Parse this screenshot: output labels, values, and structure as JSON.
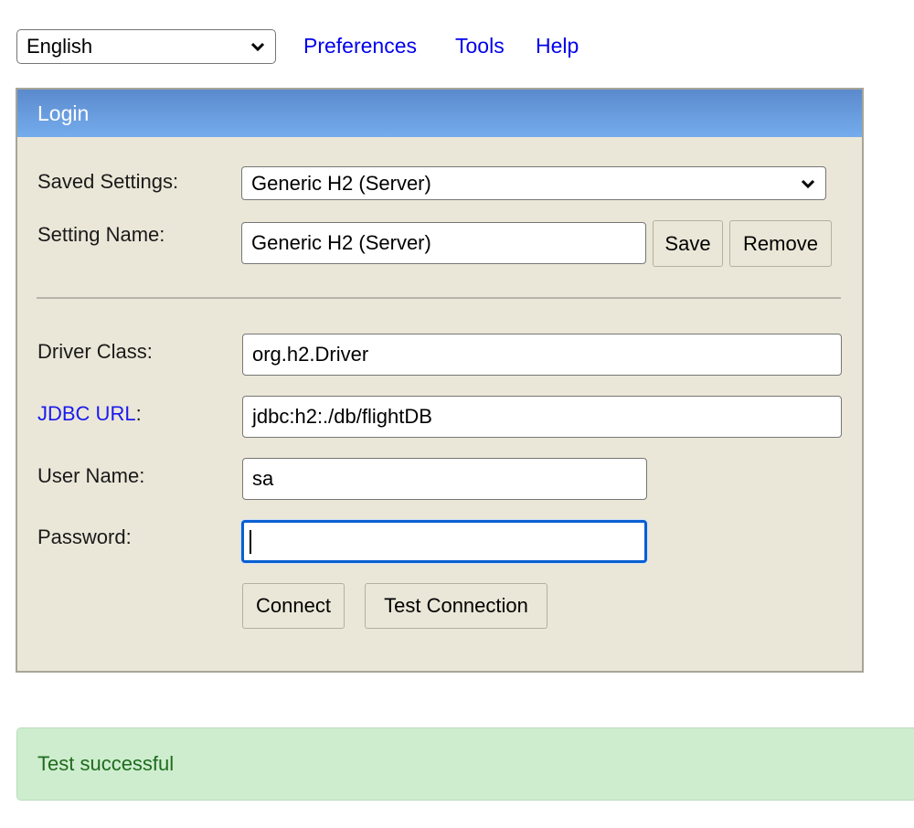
{
  "topbar": {
    "language": {
      "selected": "English",
      "icon": "chevron-down-icon"
    },
    "links": [
      "Preferences",
      "Tools",
      "Help"
    ]
  },
  "panel": {
    "title": "Login",
    "saved_settings": {
      "label": "Saved Settings:",
      "value": "Generic H2 (Server)"
    },
    "setting_name": {
      "label": "Setting Name:",
      "value": "Generic H2 (Server)"
    },
    "save_label": "Save",
    "remove_label": "Remove",
    "driver_class": {
      "label": "Driver Class:",
      "value": "org.h2.Driver"
    },
    "jdbc_url": {
      "label": "JDBC URL",
      "label_suffix": ":",
      "value": "jdbc:h2:./db/flightDB"
    },
    "user_name": {
      "label": "User Name:",
      "value": "sa"
    },
    "password": {
      "label": "Password:",
      "value": ""
    },
    "connect_label": "Connect",
    "test_connection_label": "Test Connection"
  },
  "status": {
    "message": "Test successful"
  },
  "colors": {
    "header_gradient_top": "#5b8acd",
    "header_gradient_bottom": "#74aced",
    "panel_bg": "#ebe7d8",
    "link": "#0000ee",
    "focus": "#0a5fd1",
    "success_bg": "#ceedce",
    "success_text": "#1e6b1e"
  }
}
